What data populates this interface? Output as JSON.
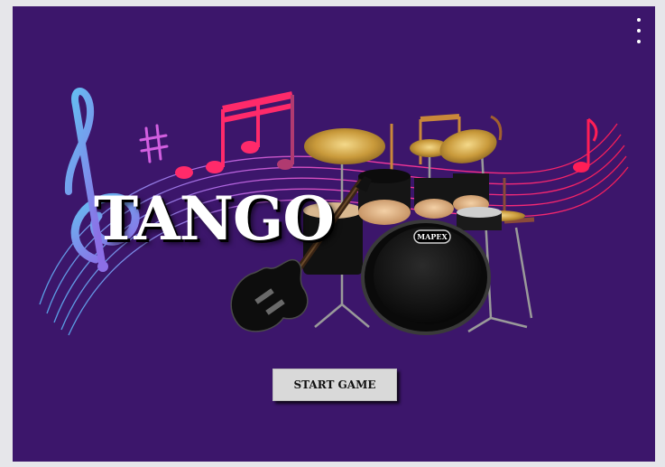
{
  "game": {
    "title": "TANGO",
    "start_button_label": "START GAME",
    "drum_brand": "MAPEX",
    "menu_icon": "more-vertical-icon"
  },
  "colors": {
    "background": "#3c166b",
    "page": "#e6e6ea",
    "button": "#d9d9d9",
    "button_text": "#111111",
    "title": "#ffffff"
  }
}
